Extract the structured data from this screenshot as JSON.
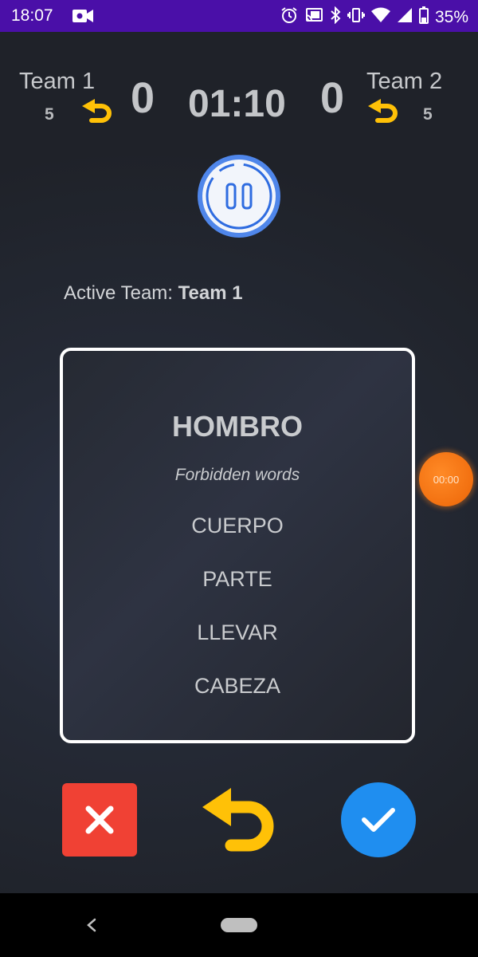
{
  "status_bar": {
    "time": "18:07",
    "battery_pct": "35%"
  },
  "team1": {
    "name": "Team 1",
    "turns": "5",
    "score": "0"
  },
  "team2": {
    "name": "Team 2",
    "turns": "5",
    "score": "0"
  },
  "timer": "01:10",
  "active_team": {
    "label": "Active Team:",
    "name": "Team 1"
  },
  "card": {
    "word": "HOMBRO",
    "forbidden_label": "Forbidden words",
    "forbidden": [
      "CUERPO",
      "PARTE",
      "LLEVAR",
      "CABEZA"
    ]
  },
  "bubble_timer": "00:00",
  "icons": {
    "pause": "pause-icon",
    "undo": "undo-icon",
    "reject": "close-icon",
    "accept": "check-icon"
  },
  "colors": {
    "accent_yellow": "#ffc107",
    "reject_red": "#f04134",
    "accept_blue": "#1f8ef0",
    "status_bar": "#4a0fa8",
    "pause_blue": "#2f6ce0"
  }
}
